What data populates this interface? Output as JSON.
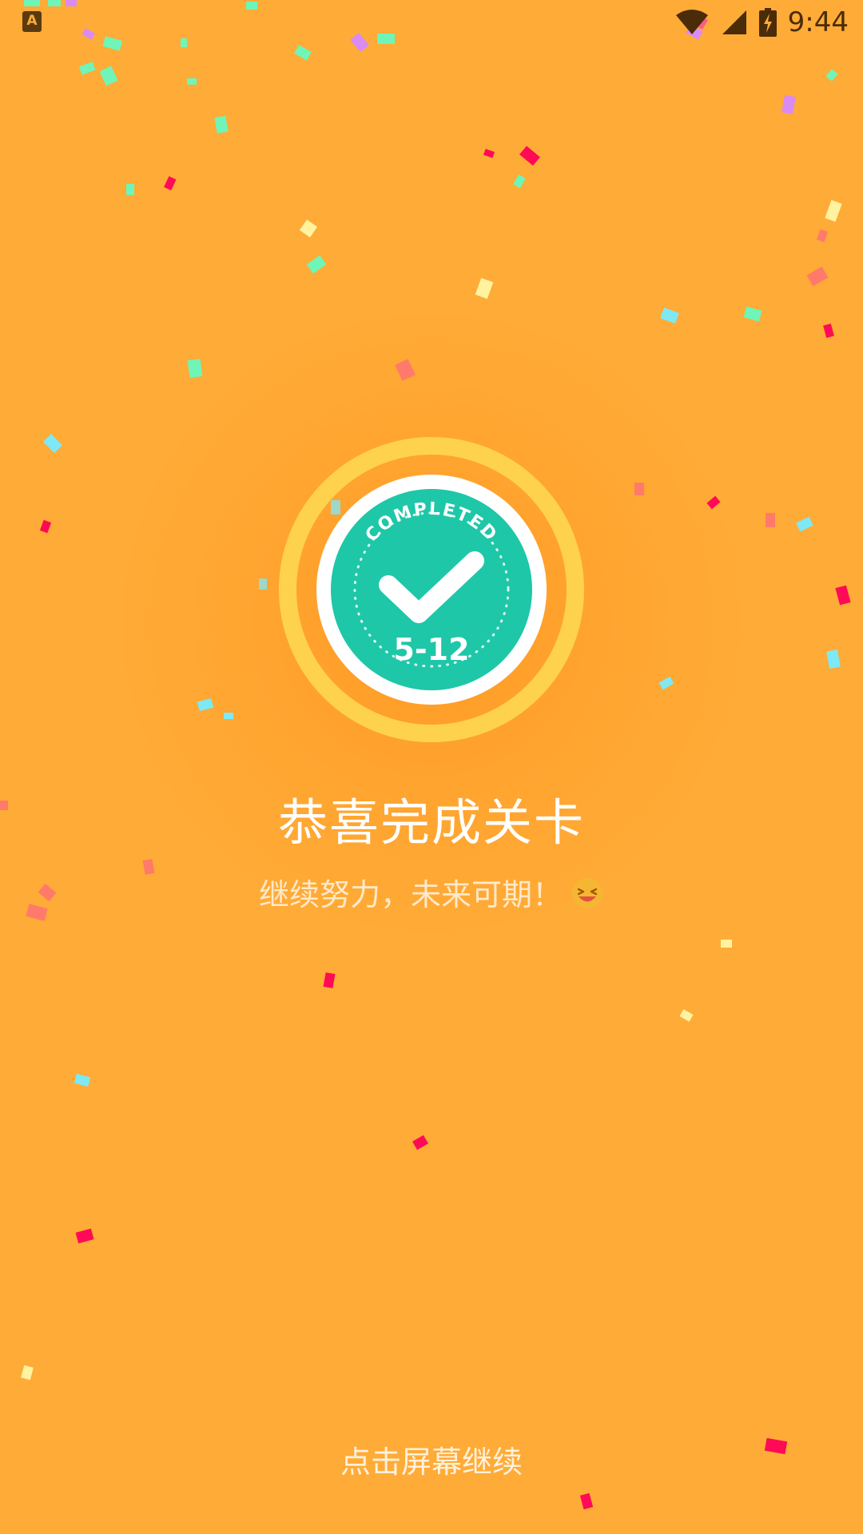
{
  "status_bar": {
    "app_indicator": "A",
    "clock": "9:44",
    "icons": [
      "wifi-icon",
      "signal-icon",
      "battery-charging-icon"
    ]
  },
  "badge": {
    "arc_text": "COMPLETED",
    "level": "5-12",
    "icon": "checkmark-icon"
  },
  "title": "恭喜完成关卡",
  "subtitle": "继续努力，未来可期！",
  "subtitle_emoji": "laughing-face-emoji",
  "continue_hint": "点击屏幕继续",
  "colors": {
    "background": "#FFAB37",
    "ring": "#FFD24D",
    "badge_fill": "#1EC7A8",
    "badge_border": "#FFFFFF",
    "text": "#FFFFFF"
  }
}
